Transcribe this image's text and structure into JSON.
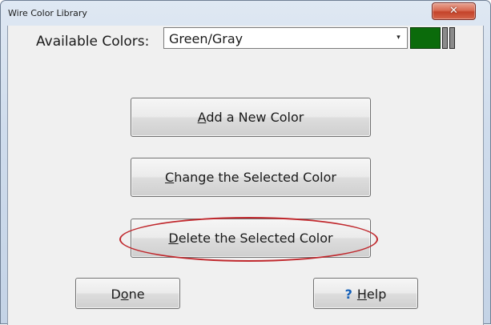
{
  "window": {
    "title": "Wire Color Library",
    "close_glyph": "✕"
  },
  "colors": {
    "label": "Available Colors:",
    "selected": "Green/Gray",
    "swatch_main": "#0b6b0b",
    "swatch_stripe": "#8b8b8b",
    "dropdown_glyph": "▾"
  },
  "buttons": {
    "add": {
      "mnemonic": "A",
      "rest": "dd a New Color"
    },
    "change": {
      "mnemonic": "C",
      "rest": "hange the Selected Color"
    },
    "delete": {
      "mnemonic": "D",
      "rest": "elete the Selected Color"
    },
    "done": {
      "pre": "D",
      "mnemonic": "o",
      "rest": "ne"
    },
    "help": {
      "icon": "?",
      "mnemonic": "H",
      "rest": "elp"
    }
  },
  "annotation": {
    "color": "#c0282d"
  }
}
